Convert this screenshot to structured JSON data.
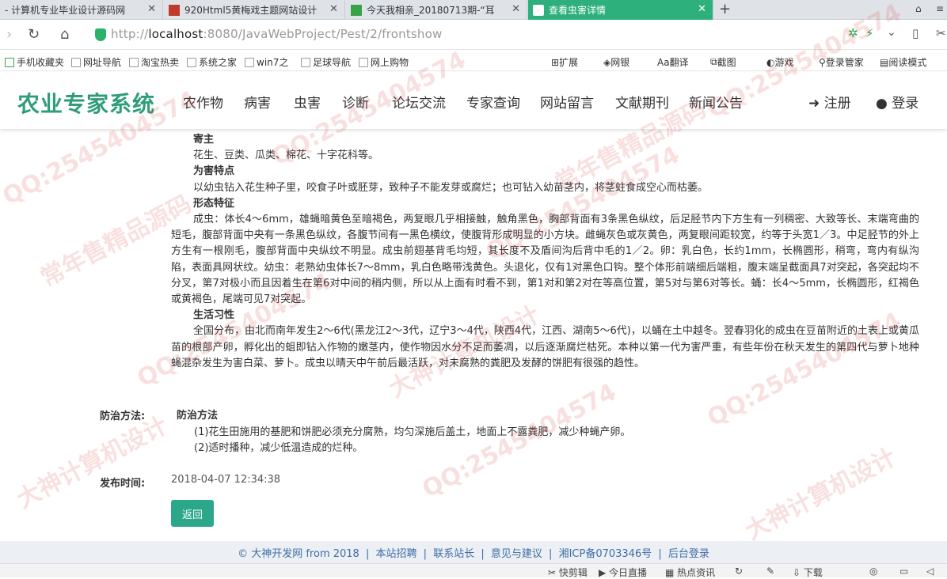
{
  "tabs": [
    {
      "title": "- 计算机专业毕业设计源码网",
      "active": false
    },
    {
      "title": "920Html5黄梅戏主题网站设计",
      "active": false
    },
    {
      "title": "今天我相亲_20180713期-“耳",
      "active": false
    },
    {
      "title": "查看虫害详情",
      "active": true
    }
  ],
  "address": {
    "protocol": "http://",
    "host": "localhost",
    "path": ":8080/JavaWebProject/Pest/2/frontshow"
  },
  "bookmarks": [
    "手机收藏夹",
    "网址导航",
    "淘宝热卖",
    "系统之家",
    "win7之",
    "足球导航",
    "网上购物"
  ],
  "toolbar_right": [
    "扩展",
    "网银",
    "翻译",
    "截图",
    "游戏",
    "登录管家",
    "阅读模式"
  ],
  "site": {
    "logo": "农业专家系统",
    "nav": [
      "农作物",
      "病害",
      "虫害",
      "诊断",
      "论坛交流",
      "专家查询",
      "网站留言",
      "文献期刊",
      "新闻公告"
    ],
    "register": "注册",
    "login": "登录"
  },
  "article": {
    "sections": [
      {
        "heading": "寄主",
        "text": "花生、豆类、瓜类、棉花、十字花科等。"
      },
      {
        "heading": "为害特点",
        "text": "以幼虫钻入花生种子里，咬食子叶或胚芽，致种子不能发芽或腐烂；也可钻入幼苗茎内，将茎蛀食成空心而枯萎。"
      },
      {
        "heading": "形态特征",
        "text": "成虫：体长4～6mm，雄蝇暗黄色至暗褐色，两复眼几乎相接触，触角黑色，胸部背面有3条黑色纵纹，后足胫节内下方生有一列稠密、大致等长、末端弯曲的短毛，腹部背面中央有一条黑色纵纹，各腹节间有一黑色横纹，使腹背形成明显的小方块。雌蝇灰色或灰黄色，两复眼间距较宽，约等于头宽1／3。中足胫节的外上方生有一根刚毛，腹部背面中央纵纹不明显。成虫前翅基背毛均短，其长度不及盾间沟后背中毛的1／2。卵：乳白色，长约1mm，长椭圆形，稍弯，弯内有纵沟陷，表面具网状纹。幼虫：老熟幼虫体长7～8mm，乳白色略带浅黄色。头退化，仅有1对黑色口钩。整个体形前端细后端粗，腹末端呈截面具7对突起，各突起均不分叉，第7对极小而且因着生在第6对中间的稍内侧，所以从上面有时看不到，第1对和第2对在等高位置，第5对与第6对等长。蛹：长4～5mm，长椭圆形，红褐色或黄褐色，尾端可见7对突起。"
      },
      {
        "heading": "生活习性",
        "text": "全国分布，由北而南年发生2～6代(黑龙江2～3代，辽宁3～4代，陕西4代，江西、湖南5～6代)，以蛹在土中越冬。翌春羽化的成虫在豆苗附近的土表上或黄瓜苗的根部产卵，孵化出的蛆即钻入作物的嫩茎内，使作物因水分不足而萎凋，以后逐渐腐烂枯死。本种以第一代为害严重，有些年份在秋天发生的第四代与萝卜地种蝇混杂发生为害白菜、萝卜。成虫以晴天中午前后最活跃，对未腐熟的粪肥及发酵的饼肥有很强的趋性。"
      }
    ]
  },
  "prevention": {
    "label": "防治方法:",
    "title": "防治方法",
    "items": [
      "(1)花生田施用的基肥和饼肥必须充分腐熟，均匀深施后盖土，地面上不露粪肥，减少种蝇产卵。",
      "(2)适时播种，减少低温造成的烂种。"
    ]
  },
  "publish": {
    "label": "发布时间:",
    "value": "2018-04-07 12:34:38"
  },
  "back_button": "返回",
  "footer": {
    "copyright": "© 大神开发网 from 2018",
    "links": [
      "本站招聘",
      "联系站长",
      "意见与建议",
      "湘ICP备0703346号",
      "后台登录"
    ],
    "separator": "|"
  },
  "statusbar": [
    "快剪辑",
    "今日直播",
    "热点资讯",
    "下载"
  ],
  "watermark": {
    "qq": "QQ:2545404574",
    "slogan1": "大神计算机设计",
    "slogan2": "常年售精品源码"
  },
  "colors": {
    "accent": "#2db07b",
    "logo": "#2f9e78",
    "button": "#2ba889",
    "footer_link": "#3e6ea8"
  }
}
